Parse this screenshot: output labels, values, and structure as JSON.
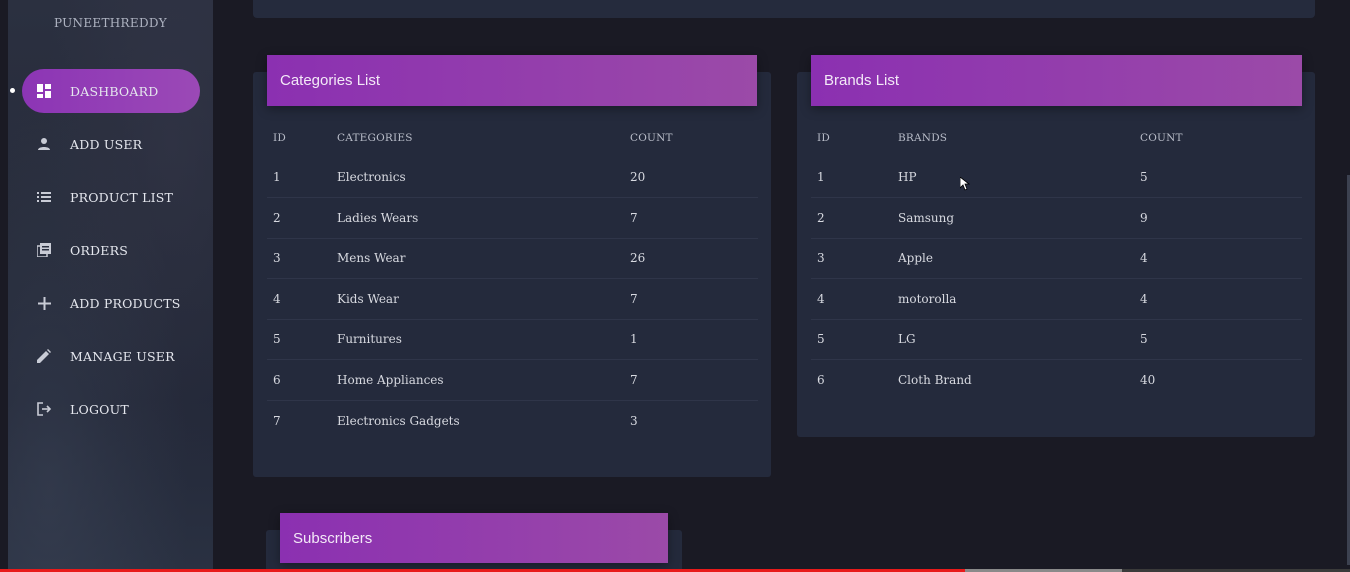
{
  "sidebar": {
    "brand": "PUNEETHREDDY",
    "items": [
      {
        "label": "DASHBOARD",
        "icon": "dashboard-icon",
        "active": true
      },
      {
        "label": "ADD USER",
        "icon": "user-icon"
      },
      {
        "label": "PRODUCT LIST",
        "icon": "list-icon"
      },
      {
        "label": "ORDERS",
        "icon": "orders-icon"
      },
      {
        "label": "ADD PRODUCTS",
        "icon": "plus-icon"
      },
      {
        "label": "MANAGE USER",
        "icon": "pencil-icon"
      },
      {
        "label": "LOGOUT",
        "icon": "logout-icon"
      }
    ]
  },
  "categories": {
    "title": "Categories List",
    "headers": [
      "ID",
      "CATEGORIES",
      "COUNT"
    ],
    "rows": [
      [
        "1",
        "Electronics",
        "20"
      ],
      [
        "2",
        "Ladies Wears",
        "7"
      ],
      [
        "3",
        "Mens Wear",
        "26"
      ],
      [
        "4",
        "Kids Wear",
        "7"
      ],
      [
        "5",
        "Furnitures",
        "1"
      ],
      [
        "6",
        "Home Appliances",
        "7"
      ],
      [
        "7",
        "Electronics Gadgets",
        "3"
      ]
    ]
  },
  "brands": {
    "title": "Brands List",
    "headers": [
      "ID",
      "BRANDS",
      "COUNT"
    ],
    "rows": [
      [
        "1",
        "HP",
        "5"
      ],
      [
        "2",
        "Samsung",
        "9"
      ],
      [
        "3",
        "Apple",
        "4"
      ],
      [
        "4",
        "motorolla",
        "4"
      ],
      [
        "5",
        "LG",
        "5"
      ],
      [
        "6",
        "Cloth Brand",
        "40"
      ]
    ]
  },
  "subscribers": {
    "title": "Subscribers"
  },
  "colors": {
    "accent": "#8c35b5",
    "background": "#1a1a24",
    "card": "#242a3c",
    "video_progress": "#e81a1a"
  }
}
